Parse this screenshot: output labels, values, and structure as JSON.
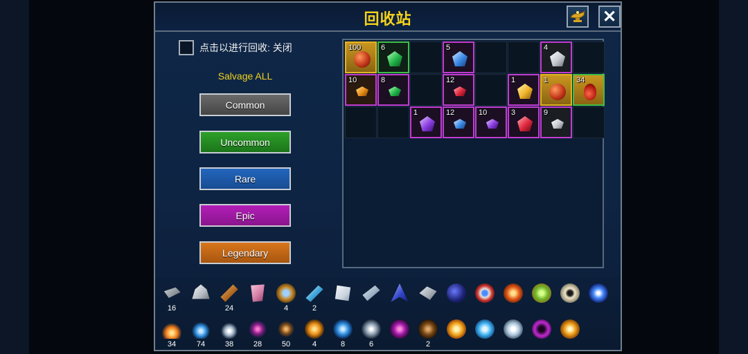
{
  "title": "回收站",
  "toggle": {
    "label": "点击以进行回收: 关闭"
  },
  "salvage_all": "Salvage ALL",
  "rarity_buttons": {
    "common": "Common",
    "uncommon": "Uncommon",
    "rare": "Rare",
    "epic": "Epic",
    "legendary": "Legendary"
  },
  "header_buttons": {
    "close_glyph": "✕"
  },
  "grid": {
    "row1": [
      {
        "count": "100",
        "icon": "red-orb-icon"
      },
      {
        "count": "6",
        "icon": "green-gem-icon"
      },
      {
        "count": "",
        "icon": ""
      },
      {
        "count": "5",
        "icon": "blue-gem-icon"
      },
      {
        "count": "",
        "icon": ""
      },
      {
        "count": "",
        "icon": ""
      },
      {
        "count": "4",
        "icon": "white-gem-icon"
      },
      {
        "count": "",
        "icon": ""
      }
    ],
    "row2": [
      {
        "count": "10",
        "icon": "orange-gem-icon"
      },
      {
        "count": "8",
        "icon": "green-gem-icon"
      },
      {
        "count": "",
        "icon": ""
      },
      {
        "count": "12",
        "icon": "red-gem-icon"
      },
      {
        "count": "",
        "icon": ""
      },
      {
        "count": "1",
        "icon": "yellow-gem-icon"
      },
      {
        "count": "1",
        "icon": "red-orb-icon"
      },
      {
        "count": "34",
        "icon": "red-potion-icon"
      }
    ],
    "row3": [
      {
        "count": "",
        "icon": ""
      },
      {
        "count": "",
        "icon": ""
      },
      {
        "count": "1",
        "icon": "purple-gem-icon"
      },
      {
        "count": "12",
        "icon": "blue-gem-icon"
      },
      {
        "count": "10",
        "icon": "purple-gem-icon"
      },
      {
        "count": "3",
        "icon": "red-gem-icon"
      },
      {
        "count": "9",
        "icon": "white-gem-icon"
      },
      {
        "count": "",
        "icon": ""
      }
    ]
  },
  "resources": {
    "row1": [
      {
        "count": "16",
        "icon": "iron-bar-icon"
      },
      {
        "count": "",
        "icon": "ore-chunk-icon"
      },
      {
        "count": "24",
        "icon": "wood-log-icon"
      },
      {
        "count": "",
        "icon": "cloth-icon"
      },
      {
        "count": "4",
        "icon": "relic-icon"
      },
      {
        "count": "2",
        "icon": "crystal-tube-icon"
      },
      {
        "count": "",
        "icon": "silver-plate-icon"
      },
      {
        "count": "",
        "icon": "steel-bar-icon"
      },
      {
        "count": "",
        "icon": "blue-feather-icon"
      },
      {
        "count": "",
        "icon": "silver-ore-icon"
      },
      {
        "count": "",
        "icon": "dark-orb-icon"
      },
      {
        "count": "",
        "icon": "eye-amulet-icon"
      },
      {
        "count": "",
        "icon": "fire-amulet-icon"
      },
      {
        "count": "",
        "icon": "green-amulet-icon"
      },
      {
        "count": "",
        "icon": "silver-amulet-icon"
      },
      {
        "count": "",
        "icon": "blue-orb-icon"
      }
    ],
    "row2": [
      {
        "count": "34",
        "icon": "fire-essence-icon"
      },
      {
        "count": "74",
        "icon": "water-essence-icon"
      },
      {
        "count": "38",
        "icon": "wind-essence-icon"
      },
      {
        "count": "28",
        "icon": "void-essence-icon"
      },
      {
        "count": "50",
        "icon": "earth-essence-icon"
      },
      {
        "count": "4",
        "icon": "fire-swirl-icon"
      },
      {
        "count": "8",
        "icon": "water-swirl-icon"
      },
      {
        "count": "6",
        "icon": "wind-swirl-icon"
      },
      {
        "count": "",
        "icon": "void-swirl-icon"
      },
      {
        "count": "2",
        "icon": "earth-swirl-icon"
      },
      {
        "count": "",
        "icon": "fire-core-icon"
      },
      {
        "count": "",
        "icon": "water-core-icon"
      },
      {
        "count": "",
        "icon": "wind-core-icon"
      },
      {
        "count": "",
        "icon": "void-core-icon"
      },
      {
        "count": "",
        "icon": "sun-core-icon"
      }
    ]
  },
  "colors": {
    "title": "#f4d21c",
    "epic_border": "#c23cd0",
    "uncommon_border": "#3fbf45",
    "legendary_fill": "#c9961f"
  }
}
